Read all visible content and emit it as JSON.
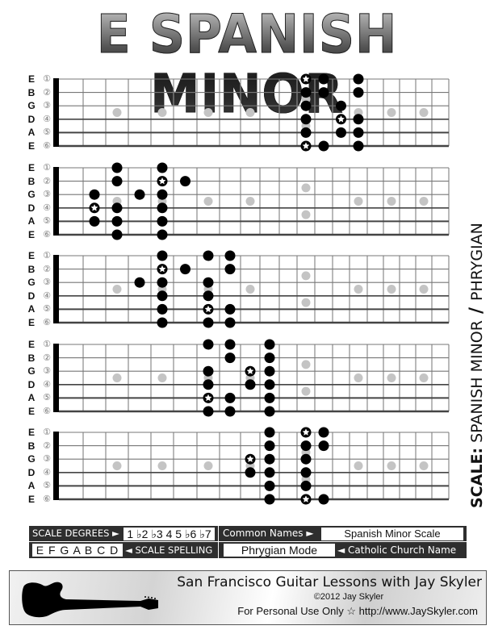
{
  "title": "E SPANISH MINOR",
  "side_label": {
    "prefix": "SCALE:",
    "name": "SPANISH MINOR",
    "slash": "/",
    "alt": "PHRYGIAN"
  },
  "strings": [
    {
      "note": "E",
      "num": "①"
    },
    {
      "note": "B",
      "num": "②"
    },
    {
      "note": "G",
      "num": "③"
    },
    {
      "note": "D",
      "num": "④"
    },
    {
      "note": "A",
      "num": "⑤"
    },
    {
      "note": "E",
      "num": "⑥"
    }
  ],
  "colors": {
    "note": "#000000",
    "inlay": "#c4c4c4",
    "fret": "#8a8a8a",
    "string": "#444444",
    "panel": "#2e2e2e"
  },
  "inlay_frets": [
    3,
    5,
    7,
    9,
    15,
    17,
    19
  ],
  "double_inlay_fret": 12,
  "diagrams": [
    {
      "name": "position-1",
      "notes": [
        {
          "string": 1,
          "fret": 12,
          "root": true
        },
        {
          "string": 1,
          "fret": 13
        },
        {
          "string": 1,
          "fret": 15
        },
        {
          "string": 2,
          "fret": 12
        },
        {
          "string": 2,
          "fret": 13
        },
        {
          "string": 2,
          "fret": 15
        },
        {
          "string": 3,
          "fret": 12
        },
        {
          "string": 3,
          "fret": 14
        },
        {
          "string": 4,
          "fret": 12
        },
        {
          "string": 4,
          "fret": 14,
          "root": true
        },
        {
          "string": 4,
          "fret": 15
        },
        {
          "string": 5,
          "fret": 12
        },
        {
          "string": 5,
          "fret": 14
        },
        {
          "string": 5,
          "fret": 15
        },
        {
          "string": 6,
          "fret": 12,
          "root": true
        },
        {
          "string": 6,
          "fret": 13
        },
        {
          "string": 6,
          "fret": 15
        }
      ]
    },
    {
      "name": "position-2",
      "notes": [
        {
          "string": 1,
          "fret": 3
        },
        {
          "string": 1,
          "fret": 5
        },
        {
          "string": 2,
          "fret": 3
        },
        {
          "string": 2,
          "fret": 5,
          "root": true
        },
        {
          "string": 2,
          "fret": 6
        },
        {
          "string": 3,
          "fret": 2
        },
        {
          "string": 3,
          "fret": 4
        },
        {
          "string": 3,
          "fret": 5
        },
        {
          "string": 4,
          "fret": 2,
          "root": true
        },
        {
          "string": 4,
          "fret": 3
        },
        {
          "string": 4,
          "fret": 5
        },
        {
          "string": 5,
          "fret": 2
        },
        {
          "string": 5,
          "fret": 3
        },
        {
          "string": 5,
          "fret": 5
        },
        {
          "string": 6,
          "fret": 3
        },
        {
          "string": 6,
          "fret": 5
        }
      ]
    },
    {
      "name": "position-3",
      "notes": [
        {
          "string": 1,
          "fret": 5
        },
        {
          "string": 1,
          "fret": 7
        },
        {
          "string": 1,
          "fret": 8
        },
        {
          "string": 2,
          "fret": 5,
          "root": true
        },
        {
          "string": 2,
          "fret": 6
        },
        {
          "string": 2,
          "fret": 8
        },
        {
          "string": 3,
          "fret": 4
        },
        {
          "string": 3,
          "fret": 5
        },
        {
          "string": 3,
          "fret": 7
        },
        {
          "string": 4,
          "fret": 5
        },
        {
          "string": 4,
          "fret": 7
        },
        {
          "string": 5,
          "fret": 5
        },
        {
          "string": 5,
          "fret": 7,
          "root": true
        },
        {
          "string": 5,
          "fret": 8
        },
        {
          "string": 6,
          "fret": 5
        },
        {
          "string": 6,
          "fret": 7
        },
        {
          "string": 6,
          "fret": 8
        }
      ]
    },
    {
      "name": "position-4",
      "notes": [
        {
          "string": 1,
          "fret": 7
        },
        {
          "string": 1,
          "fret": 8
        },
        {
          "string": 1,
          "fret": 10
        },
        {
          "string": 2,
          "fret": 8
        },
        {
          "string": 2,
          "fret": 10
        },
        {
          "string": 3,
          "fret": 7
        },
        {
          "string": 3,
          "fret": 9,
          "root": true
        },
        {
          "string": 3,
          "fret": 10
        },
        {
          "string": 4,
          "fret": 7
        },
        {
          "string": 4,
          "fret": 9
        },
        {
          "string": 4,
          "fret": 10
        },
        {
          "string": 5,
          "fret": 7,
          "root": true
        },
        {
          "string": 5,
          "fret": 8
        },
        {
          "string": 5,
          "fret": 10
        },
        {
          "string": 6,
          "fret": 7
        },
        {
          "string": 6,
          "fret": 8
        },
        {
          "string": 6,
          "fret": 10
        }
      ]
    },
    {
      "name": "position-5",
      "notes": [
        {
          "string": 1,
          "fret": 10
        },
        {
          "string": 1,
          "fret": 12,
          "root": true
        },
        {
          "string": 1,
          "fret": 13
        },
        {
          "string": 2,
          "fret": 10
        },
        {
          "string": 2,
          "fret": 12
        },
        {
          "string": 2,
          "fret": 13
        },
        {
          "string": 3,
          "fret": 9,
          "root": true
        },
        {
          "string": 3,
          "fret": 10
        },
        {
          "string": 3,
          "fret": 12
        },
        {
          "string": 4,
          "fret": 9
        },
        {
          "string": 4,
          "fret": 10
        },
        {
          "string": 4,
          "fret": 12
        },
        {
          "string": 5,
          "fret": 10
        },
        {
          "string": 5,
          "fret": 12
        },
        {
          "string": 6,
          "fret": 10
        },
        {
          "string": 6,
          "fret": 12,
          "root": true
        },
        {
          "string": 6,
          "fret": 13
        }
      ]
    }
  ],
  "info": {
    "scale_degrees_label": "SCALE DEGREES ►",
    "scale_degrees": "1 ♭2 ♭3 4 5 ♭6 ♭7",
    "common_names_label": "Common Names ►",
    "common_name": "Spanish Minor Scale",
    "scale_spelling": "E F G A B C D",
    "scale_spelling_label": "◄ SCALE SPELLING",
    "church_name": "Phrygian Mode",
    "church_name_label": "◄ Catholic Church Name"
  },
  "footer": {
    "headline": "San Francisco Guitar Lessons with Jay Skyler",
    "copyright": "©2012 Jay Skyler",
    "usage": "For Personal Use Only  ☆  http://www.JaySkyler.com"
  }
}
